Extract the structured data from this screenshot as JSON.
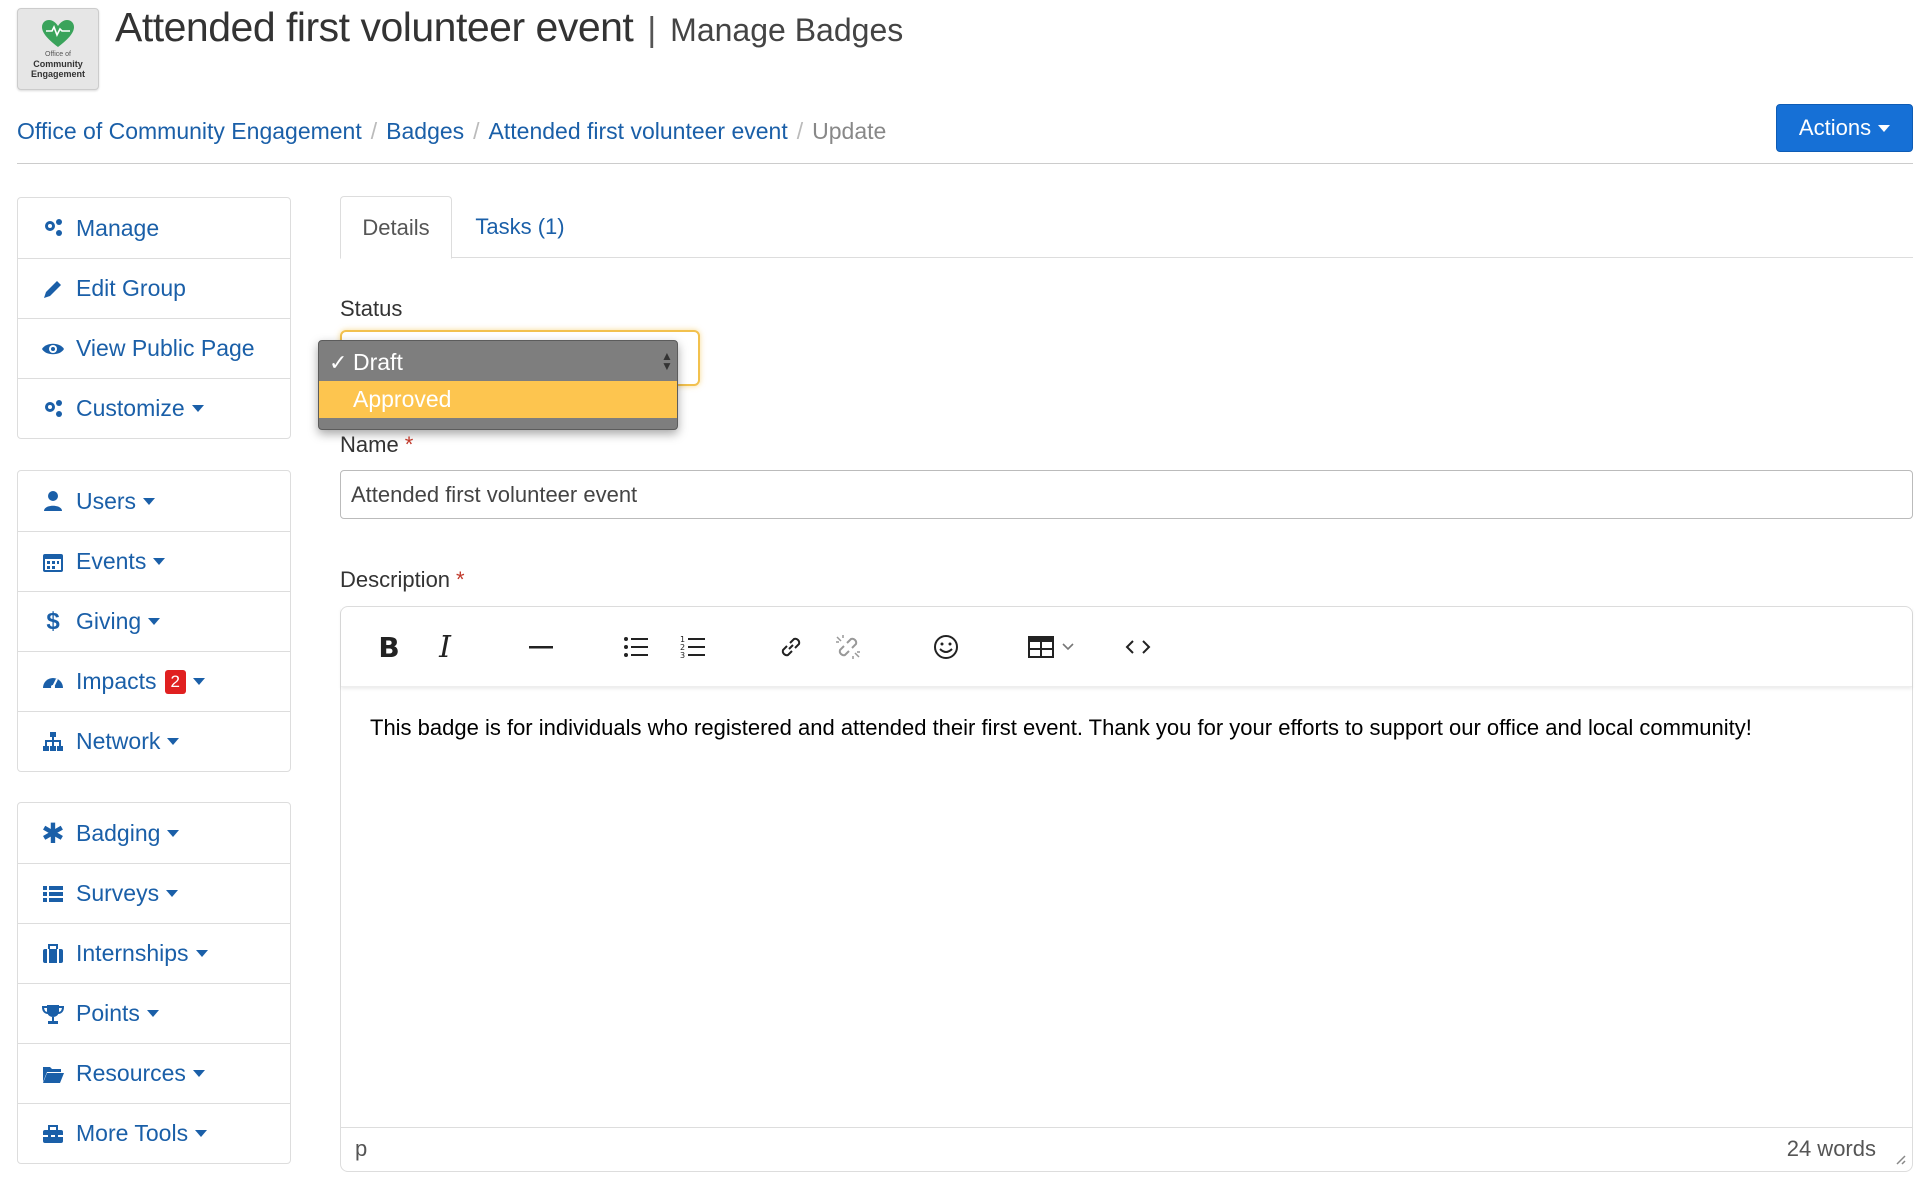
{
  "logo": {
    "sub": "Office of",
    "brand": "Community Engagement",
    "heart_color": "#3aa35b"
  },
  "header": {
    "title": "Attended first volunteer event",
    "separator": "|",
    "subtitle": "Manage Badges"
  },
  "breadcrumb": {
    "items": [
      "Office of Community Engagement",
      "Badges",
      "Attended first volunteer event"
    ],
    "current": "Update",
    "separator": "/"
  },
  "actions": {
    "label": "Actions"
  },
  "sidebar": {
    "group1": [
      {
        "label": "Manage",
        "icon": "gears-icon"
      },
      {
        "label": "Edit Group",
        "icon": "pencil-icon"
      },
      {
        "label": "View Public Page",
        "icon": "eye-icon"
      },
      {
        "label": "Customize",
        "icon": "gears-icon"
      }
    ],
    "group2": [
      {
        "label": "Users",
        "icon": "user-icon"
      },
      {
        "label": "Events",
        "icon": "calendar-icon"
      },
      {
        "label": "Giving",
        "icon": "dollar-icon"
      },
      {
        "label": "Impacts",
        "icon": "dashboard-icon",
        "badge": "2"
      },
      {
        "label": "Network",
        "icon": "sitemap-icon"
      }
    ],
    "group3": [
      {
        "label": "Badging",
        "icon": "asterisk-icon"
      },
      {
        "label": "Surveys",
        "icon": "list-icon"
      },
      {
        "label": "Internships",
        "icon": "briefcase-icon"
      },
      {
        "label": "Points",
        "icon": "trophy-icon"
      },
      {
        "label": "Resources",
        "icon": "folder-open-icon"
      },
      {
        "label": "More Tools",
        "icon": "toolbox-icon"
      }
    ]
  },
  "tabs": {
    "details": "Details",
    "tasks": "Tasks (1)"
  },
  "form": {
    "status_label": "Status",
    "status_options": [
      "Draft",
      "Approved"
    ],
    "status_selected": "Draft",
    "status_checkmark": "✓",
    "name_label": "Name",
    "name_value": "Attended first volunteer event",
    "description_label": "Description",
    "required_mark": "*"
  },
  "editor": {
    "content": "This badge is for individuals who registered and attended their first event. Thank you for your efforts to support our office and local community!",
    "path": "p",
    "word_count": "24 words"
  },
  "colors": {
    "link": "#1a5fa8",
    "primary": "#1670d6",
    "highlight": "#fdc54f",
    "badge": "#e02020"
  }
}
